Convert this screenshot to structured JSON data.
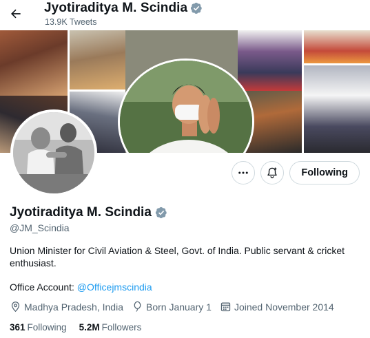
{
  "header": {
    "name": "Jyotiraditya M. Scindia",
    "tweet_count": "13.9K Tweets"
  },
  "profile": {
    "name": "Jyotiraditya M. Scindia",
    "handle": "@JM_Scindia",
    "bio": "Union Minister for Civil Aviation & Steel, Govt. of India. Public servant & cricket enthusiast.",
    "office_label": "Office Account: ",
    "office_link": "@Officejmscindia",
    "location": "Madhya Pradesh, India",
    "birthday": "Born January 1",
    "joined": "Joined November 2014",
    "following_count": "361",
    "following_label": "Following",
    "followers_count": "5.2M",
    "followers_label": "Followers"
  },
  "actions": {
    "follow_button": "Following"
  },
  "icons": {
    "back": "back-arrow-icon",
    "verified": "verified-badge-icon",
    "more": "more-icon",
    "notify": "notification-bell-icon",
    "location": "location-pin-icon",
    "birthday": "birthday-balloon-icon",
    "joined": "calendar-icon"
  },
  "colors": {
    "accent": "#1d9bf0",
    "verified": "#829aab",
    "text_primary": "#0f1419",
    "text_secondary": "#536471",
    "border": "#cfd9de"
  }
}
